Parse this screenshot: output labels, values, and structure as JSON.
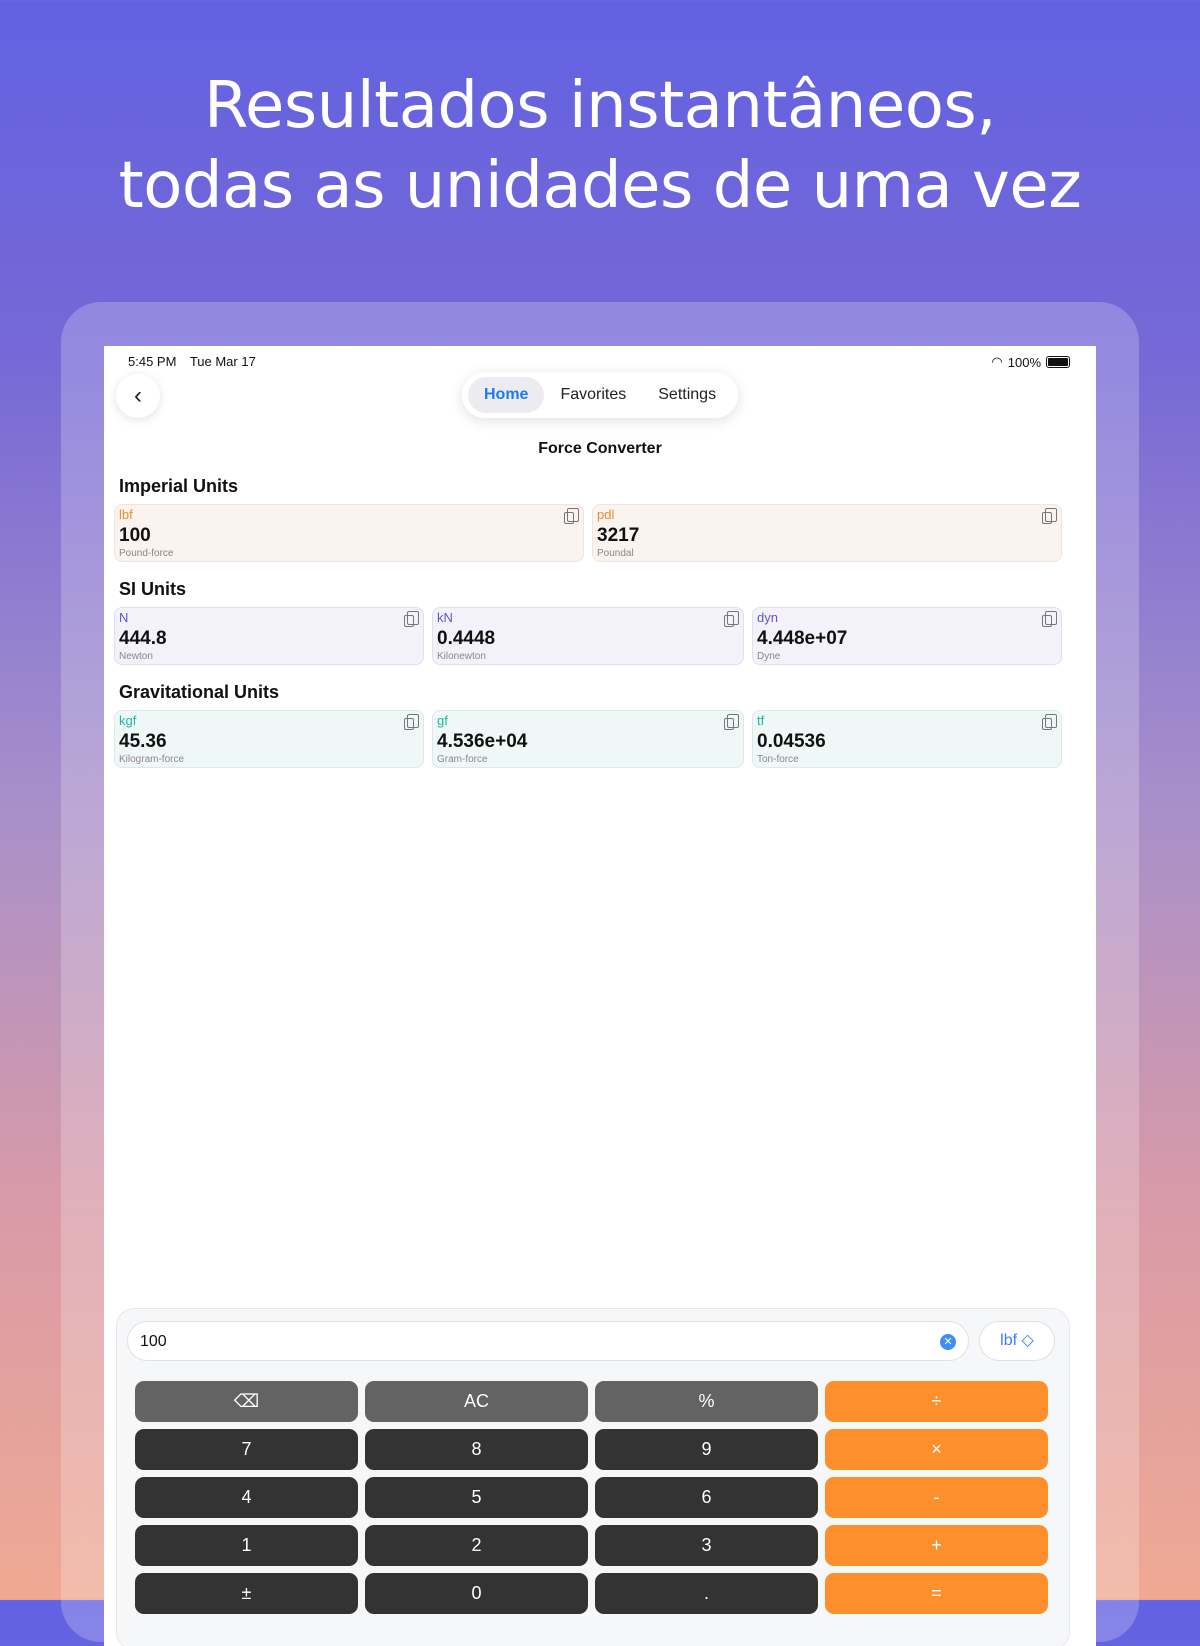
{
  "headline": {
    "line1": "Resultados instantâneos,",
    "line2": "todas as unidades de uma vez"
  },
  "status_bar": {
    "time": "5:45 PM",
    "date": "Tue Mar 17",
    "battery": "100%"
  },
  "nav": {
    "tabs": [
      {
        "label": "Home",
        "active": true
      },
      {
        "label": "Favorites",
        "active": false
      },
      {
        "label": "Settings",
        "active": false
      }
    ]
  },
  "page_title": "Force Converter",
  "sections": [
    {
      "title": "Imperial Units",
      "color": "#f0892e",
      "cards": [
        {
          "symbol": "lbf",
          "value": "100",
          "name": "Pound-force"
        },
        {
          "symbol": "pdl",
          "value": "3217",
          "name": "Poundal"
        }
      ]
    },
    {
      "title": "SI Units",
      "color": "#5d55d9",
      "cards": [
        {
          "symbol": "N",
          "value": "444.8",
          "name": "Newton"
        },
        {
          "symbol": "kN",
          "value": "0.4448",
          "name": "Kilonewton"
        },
        {
          "symbol": "dyn",
          "value": "4.448e+07",
          "name": "Dyne"
        }
      ]
    },
    {
      "title": "Gravitational Units",
      "color": "#1bb8a4",
      "cards": [
        {
          "symbol": "kgf",
          "value": "45.36",
          "name": "Kilogram-force"
        },
        {
          "symbol": "gf",
          "value": "4.536e+04",
          "name": "Gram-force"
        },
        {
          "symbol": "tf",
          "value": "0.04536",
          "name": "Ton-force"
        }
      ]
    }
  ],
  "calculator": {
    "input_value": "100",
    "unit_selector": "lbf ◇",
    "keys": [
      [
        "⌫",
        "AC",
        "%",
        "÷"
      ],
      [
        "7",
        "8",
        "9",
        "×"
      ],
      [
        "4",
        "5",
        "6",
        "-"
      ],
      [
        "1",
        "2",
        "3",
        "+"
      ],
      [
        "±",
        "0",
        ".",
        "="
      ]
    ]
  },
  "colors": {
    "accent": "#1a7cf2",
    "operator": "#fd8f2c",
    "key_dark": "#333333",
    "key_fn": "#636363"
  }
}
